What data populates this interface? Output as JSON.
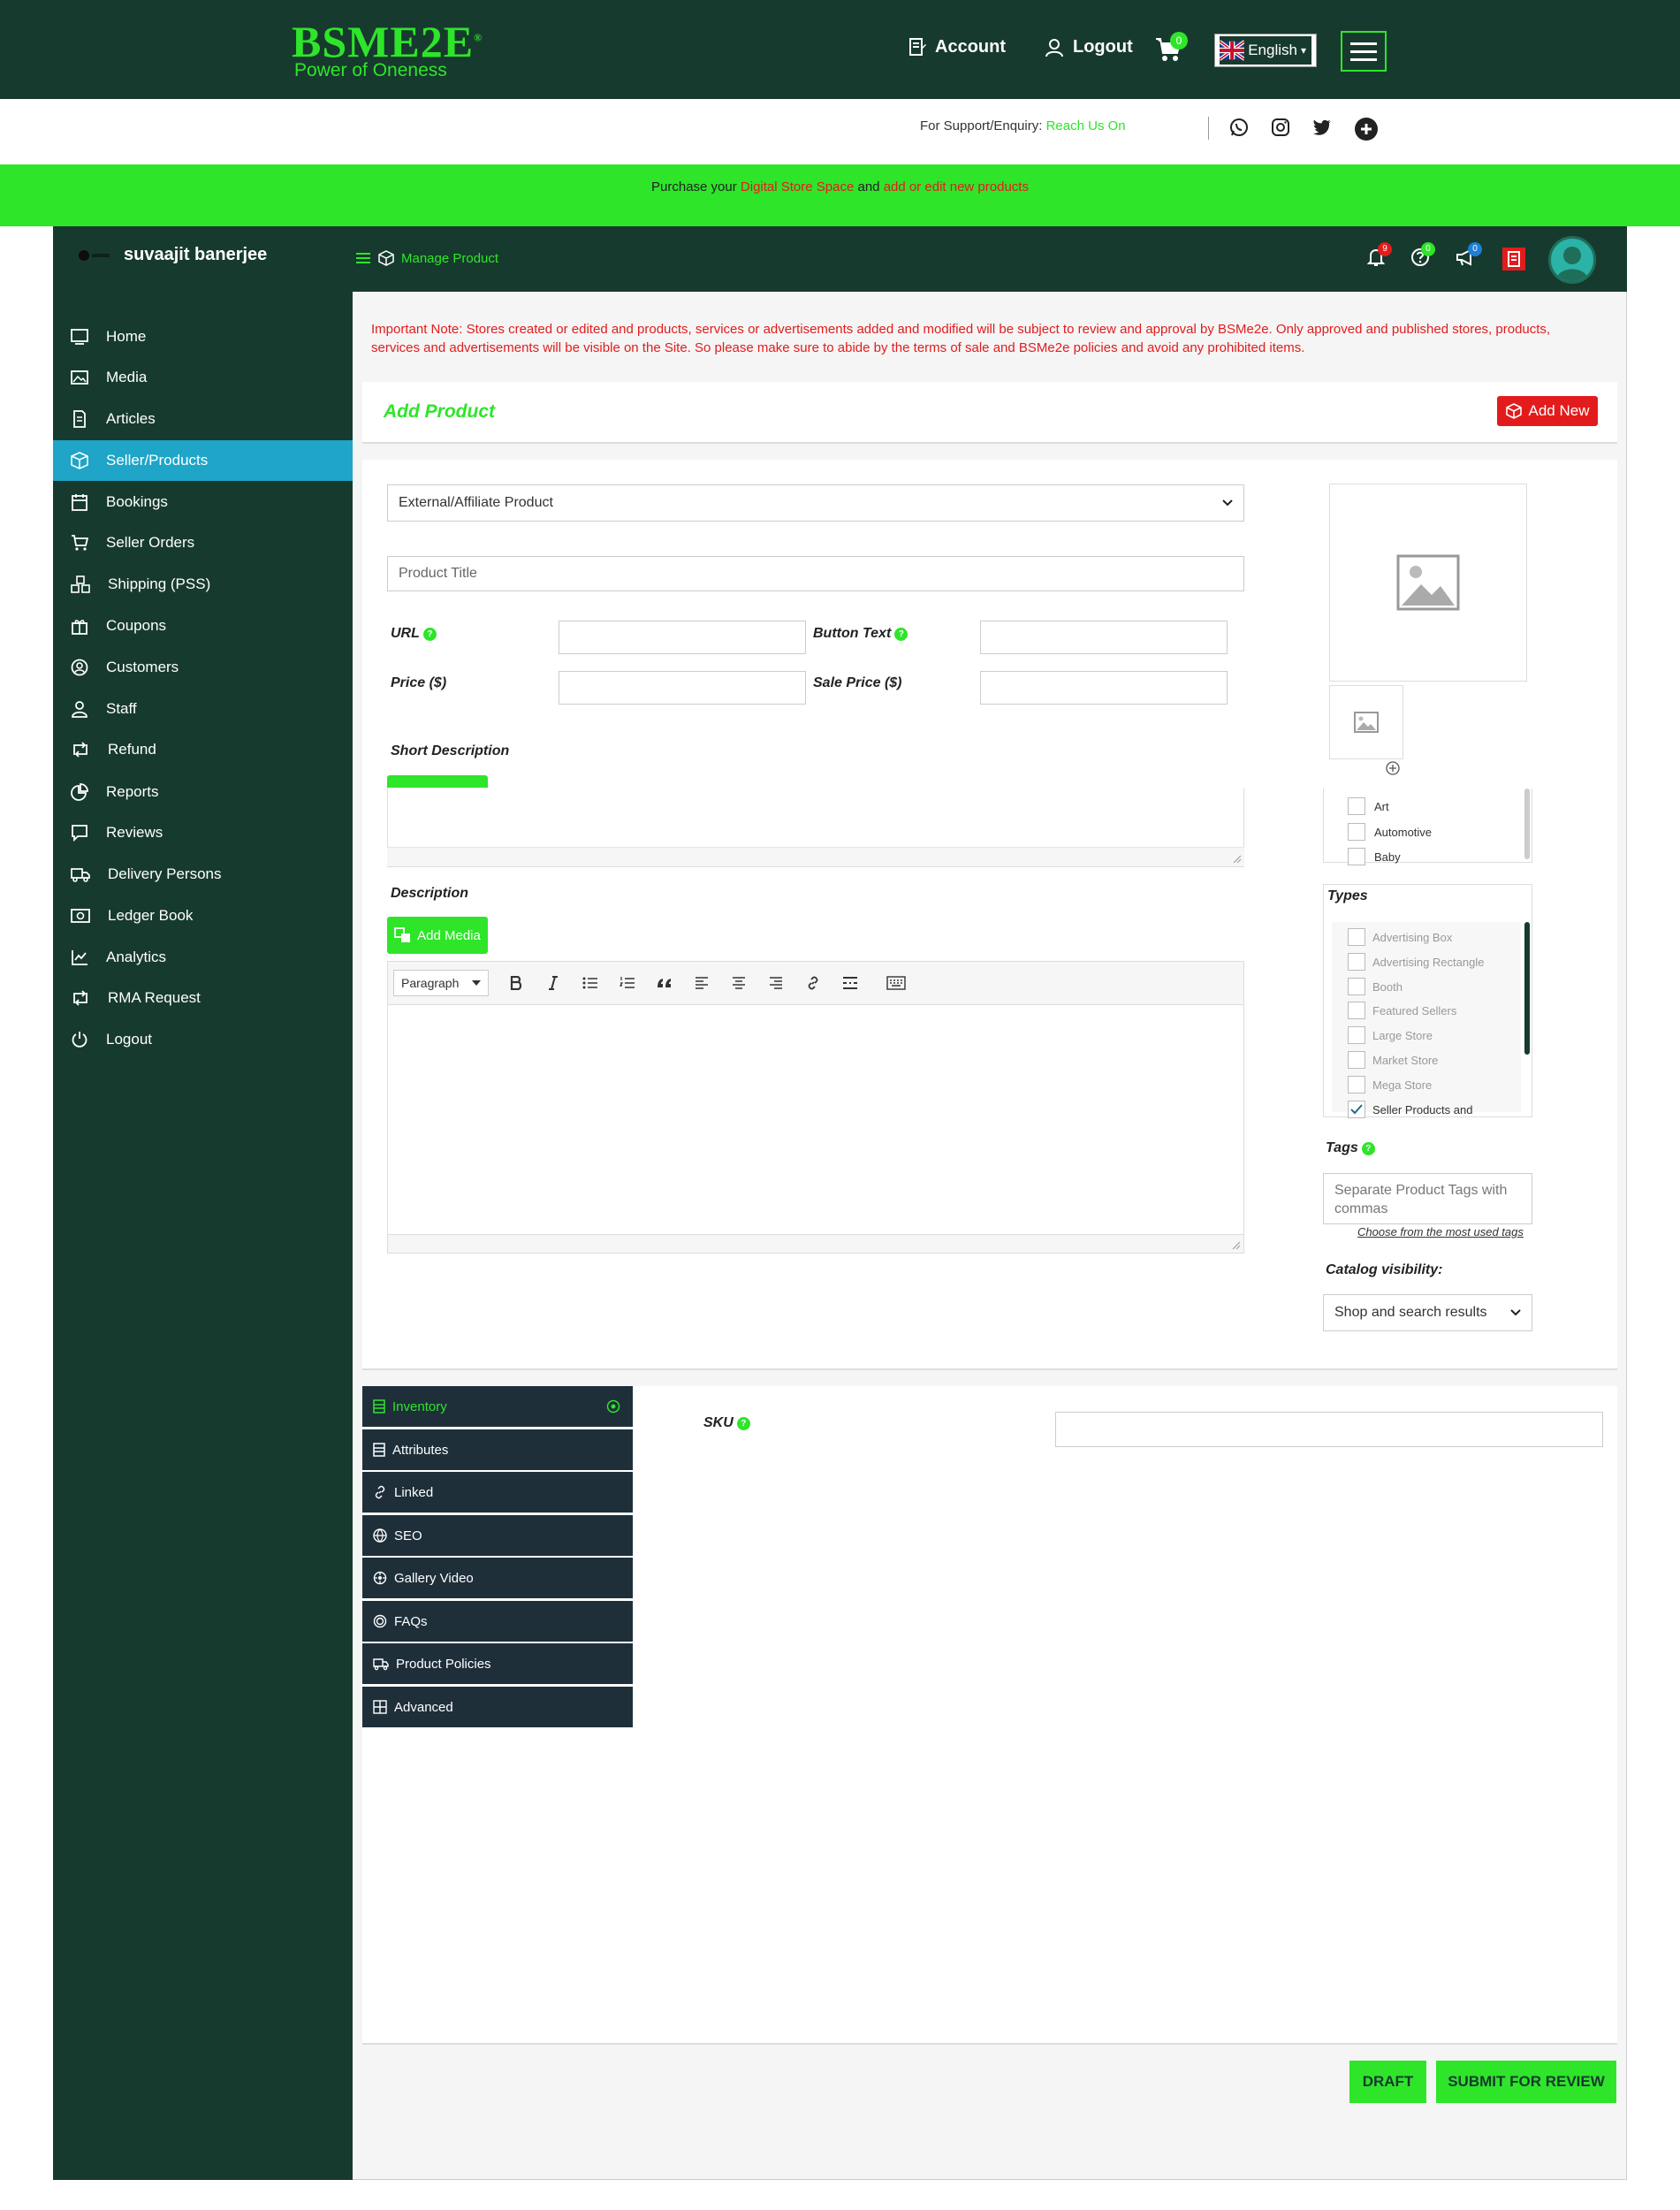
{
  "site": {
    "logo_title": "BSME2E",
    "logo_tm": "®",
    "logo_tagline": "Power of Oneness"
  },
  "topnav": {
    "account_label": "Account",
    "logout_label": "Logout",
    "cart_count": "0",
    "language_label": "English",
    "language_caret": "▾"
  },
  "support": {
    "prefix": "For Support/Enquiry:",
    "link": "Reach Us On"
  },
  "promo": {
    "part1": "Purchase your ",
    "link1": "Digital Store Space",
    "part2": " and ",
    "link2": "add or edit new products"
  },
  "dashboard": {
    "user_name": "suvaajit banerjee",
    "manage_product_label": "Manage Product",
    "notification_count": "9",
    "help_count": "0",
    "announcement_count": "0"
  },
  "sidebar": {
    "items": [
      {
        "label": "Home",
        "icon": "monitor-icon"
      },
      {
        "label": "Media",
        "icon": "image-icon"
      },
      {
        "label": "Articles",
        "icon": "document-icon"
      },
      {
        "label": "Seller/Products",
        "icon": "box-icon"
      },
      {
        "label": "Bookings",
        "icon": "calendar-icon"
      },
      {
        "label": "Seller Orders",
        "icon": "cart-icon"
      },
      {
        "label": "Shipping (PSS)",
        "icon": "boxes-icon"
      },
      {
        "label": "Coupons",
        "icon": "gift-icon"
      },
      {
        "label": "Customers",
        "icon": "user-circle-icon"
      },
      {
        "label": "Staff",
        "icon": "user-icon"
      },
      {
        "label": "Refund",
        "icon": "retweet-icon"
      },
      {
        "label": "Reports",
        "icon": "chart-pie-icon"
      },
      {
        "label": "Reviews",
        "icon": "comment-icon"
      },
      {
        "label": "Delivery Persons",
        "icon": "truck-icon"
      },
      {
        "label": "Ledger Book",
        "icon": "money-icon"
      },
      {
        "label": "Analytics",
        "icon": "line-chart-icon"
      },
      {
        "label": "RMA Request",
        "icon": "retweet-icon"
      },
      {
        "label": "Logout",
        "icon": "power-icon"
      }
    ]
  },
  "notice": {
    "prefix": "Important Note: ",
    "text": "Stores created or edited and products, services or advertisements added and modified will be subject to review and approval by BSMe2e. Only approved and published stores, products, services and advertisements will be visible on the Site. So please make sure to abide by the terms of sale and BSMe2e policies and avoid any prohibited items."
  },
  "page": {
    "title": "Add Product",
    "add_new_label": "Add New"
  },
  "form": {
    "product_type": "External/Affiliate Product",
    "product_title_placeholder": "Product Title",
    "url_label": "URL",
    "button_text_label": "Button Text",
    "price_label": "Price ($)",
    "sale_price_label": "Sale Price ($)",
    "short_description_label": "Short Description",
    "description_label": "Description",
    "add_media_label": "Add Media",
    "paragraph_label": "Paragraph",
    "help_mark": "?"
  },
  "categories": [
    "Art",
    "Automotive",
    "Baby"
  ],
  "types": {
    "label": "Types",
    "items": [
      {
        "label": "Advertising Box",
        "checked": false
      },
      {
        "label": "Advertising Rectangle",
        "checked": false
      },
      {
        "label": "Booth",
        "checked": false
      },
      {
        "label": "Featured Sellers",
        "checked": false
      },
      {
        "label": "Large Store",
        "checked": false
      },
      {
        "label": "Market Store",
        "checked": false
      },
      {
        "label": "Mega Store",
        "checked": false
      },
      {
        "label": "Seller Products and",
        "checked": true
      }
    ]
  },
  "tags": {
    "label": "Tags",
    "placeholder": "Separate Product Tags with commas",
    "link": "Choose from the most used tags"
  },
  "catalog": {
    "label": "Catalog visibility:",
    "value": "Shop and search results"
  },
  "tabs": [
    {
      "label": "Inventory",
      "icon": "database-icon",
      "active": true
    },
    {
      "label": "Attributes",
      "icon": "server-icon",
      "active": false
    },
    {
      "label": "Linked",
      "icon": "link-icon",
      "active": false
    },
    {
      "label": "SEO",
      "icon": "globe-icon",
      "active": false
    },
    {
      "label": "Gallery Video",
      "icon": "gallery-video-icon",
      "active": false
    },
    {
      "label": "FAQs",
      "icon": "faq-icon",
      "active": false
    },
    {
      "label": "Product Policies",
      "icon": "truck-icon",
      "active": false
    },
    {
      "label": "Advanced",
      "icon": "grid-icon",
      "active": false
    }
  ],
  "inventory": {
    "sku_label": "SKU"
  },
  "actions": {
    "draft_label": "DRAFT",
    "submit_label": "SUBMIT FOR REVIEW"
  },
  "colors": {
    "brand_dark": "#173a2e",
    "brand_green": "#2ee52a",
    "accent_blue": "#1ea5c8",
    "alert_red": "#e21c1c",
    "tab_dark": "#1e2f3a"
  }
}
